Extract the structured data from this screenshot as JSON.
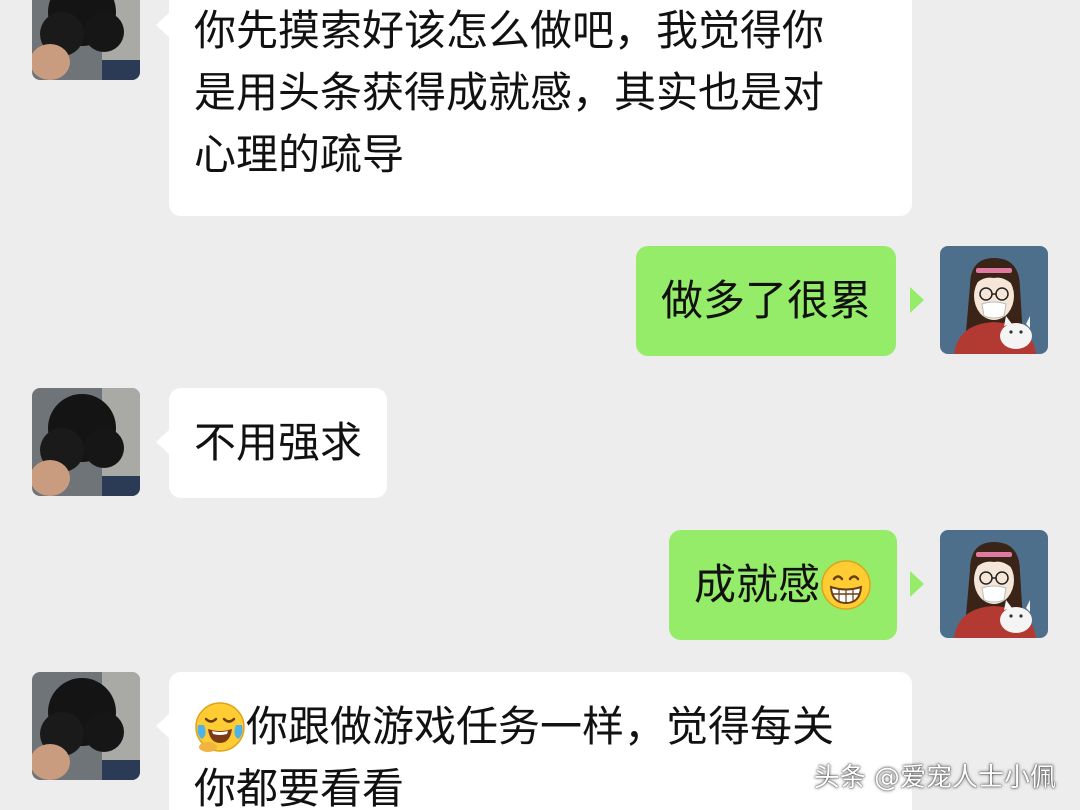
{
  "colors": {
    "background": "#ededed",
    "incoming_bubble": "#ffffff",
    "outgoing_bubble": "#95ec69",
    "text": "#111111"
  },
  "messages": [
    {
      "direction": "incoming",
      "lines": [
        "你先摸索好该怎么做吧，我觉得你",
        "是用头条获得成就感，其实也是对",
        "心理的疏导"
      ]
    },
    {
      "direction": "outgoing",
      "lines": [
        "做多了很累"
      ]
    },
    {
      "direction": "incoming",
      "lines": [
        "不用强求"
      ]
    },
    {
      "direction": "outgoing",
      "lines": [
        "成就感"
      ],
      "trailing_emoji": "grinning-face-emoji"
    },
    {
      "direction": "incoming",
      "leading_emoji": "face-with-tears-of-joy-emoji",
      "lines": [
        "你跟做游戏任务一样，觉得每关",
        "你都要看看"
      ]
    }
  ],
  "avatars": {
    "incoming": "black-poodle-avatar",
    "outgoing": "cartoon-girl-with-cat-avatar"
  },
  "watermark": "头条 @爱宠人士小佩"
}
